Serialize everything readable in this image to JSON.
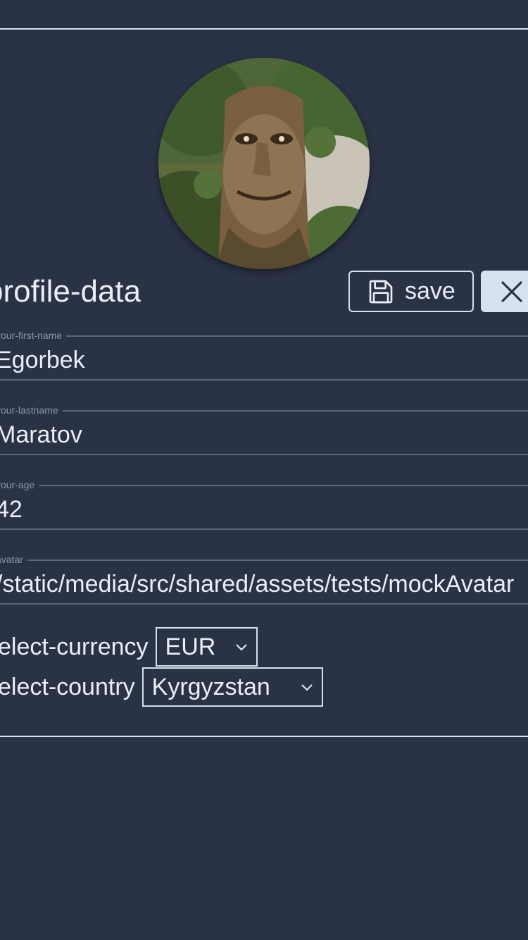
{
  "profile": {
    "title": "profile-data",
    "save_label": "save",
    "fields": {
      "first_name": {
        "label": "your-first-name",
        "value": "Egorbek"
      },
      "last_name": {
        "label": "your-lastname",
        "value": "Maratov"
      },
      "age": {
        "label": "your-age",
        "value": "42"
      },
      "avatar": {
        "label": "avatar",
        "value": "/static/media/src/shared/assets/tests/mockAvatar"
      }
    },
    "currency": {
      "label": "select-currency",
      "value": "EUR"
    },
    "country": {
      "label": "select-country",
      "value": "Kyrgyzstan"
    }
  },
  "colors": {
    "background": "#2a3246",
    "primary": "#d6e2ee",
    "text": "#e8eef6"
  },
  "icons": [
    "save-icon",
    "close-icon",
    "chevron-down-icon"
  ]
}
